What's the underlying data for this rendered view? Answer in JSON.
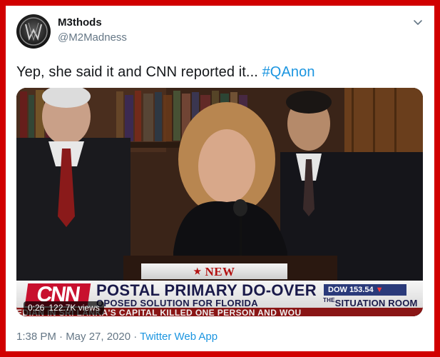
{
  "tweet": {
    "author_name": "M3thods",
    "author_handle": "@M2Madness",
    "text_before_hashtag": "Yep, she said it and CNN reported it... ",
    "hashtag": "#QAnon",
    "timestamp": "1:38 PM · May 27, 2020 · ",
    "source_app": "Twitter Web App"
  },
  "video": {
    "elapsed": "0:26",
    "views": "122.7K views",
    "banner": "NEW DEVELOPMENTS",
    "network": "CNN",
    "headline": "POSTAL PRIMARY DO-OVER",
    "subline": "OPOSED SOLUTION FOR FLORIDA",
    "dow": "DOW 153.54",
    "program": "SITUATION ROOM",
    "program_prefix": "THE",
    "ticker": "EDIAN IN SRI LANKA'S CAPITAL KILLED ONE PERSON AND WOU"
  },
  "colors": {
    "frame": "#d10000",
    "link": "#1b95e0",
    "muted": "#657786",
    "text": "#14171a",
    "cnn_red": "#c8102e"
  },
  "icons": {
    "menu": "chevron-down-icon",
    "avatar": "avatar-logo"
  }
}
